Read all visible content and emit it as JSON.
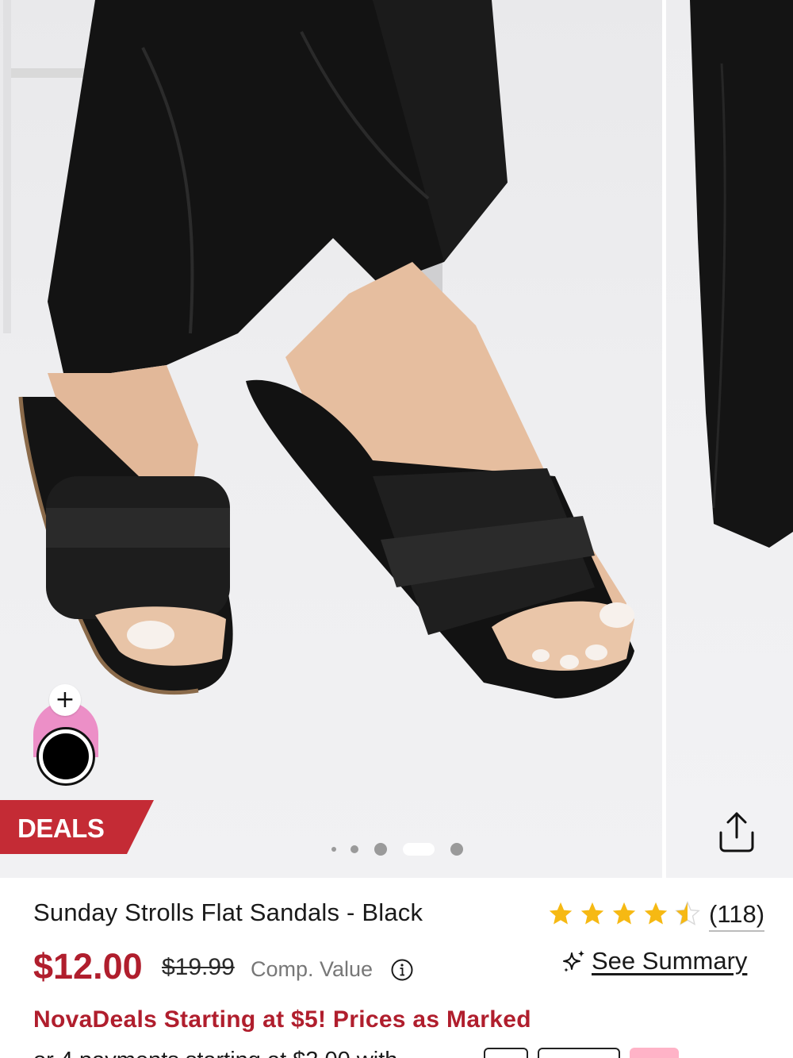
{
  "gallery": {
    "badge": "DEALS",
    "current_slide_index": 3,
    "slide_count": 5,
    "share_icon": "share-icon",
    "swatch": {
      "plus_label": "+",
      "colors": {
        "accent": "#ec8fc7",
        "selected": "#000000"
      }
    }
  },
  "product": {
    "title": "Sunday Strolls Flat Sandals - Black",
    "rating": 4.5,
    "review_count": "(118)",
    "price": "$12.00",
    "original_price": "$19.99",
    "comp_label": "Comp. Value",
    "summary_label": "See Summary",
    "promo": "NovaDeals Starting at $5! Prices as Marked",
    "payment_line": "or 4 payments starting at $3.00 with"
  },
  "colors": {
    "brand_red": "#b01e2d",
    "star_gold": "#f6b913",
    "deals_red": "#c42b35"
  }
}
